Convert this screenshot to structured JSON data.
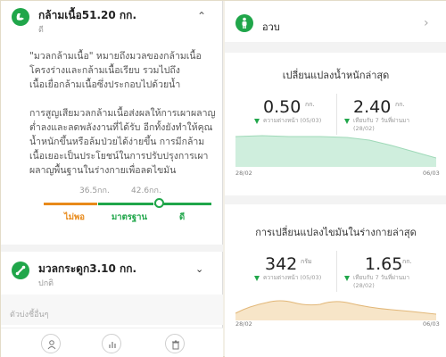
{
  "colors": {
    "accent": "#20a64a",
    "warning": "#e88a1a",
    "chart_green": "#cfeedd",
    "chart_orange": "#f7e5c8"
  },
  "muscle": {
    "title": "กล้ามเนื้อ51.20 กก.",
    "status": "ดี",
    "description": "\"มวลกล้ามเนื้อ\" หมายถึงมวลของกล้ามเนื้อโครงร่างและกล้ามเนื้อเรียบ รวมไปถึงเนื้อเยื่อกล้ามเนื้อซึ่งประกอบไปด้วยน้ำ",
    "advice": "การสูญเสียมวลกล้ามเนื้อส่งผลให้การเผาผลาญต่ำลงและลดพลังงานที่ได้รับ อีกทั้งยังทำให้คุณน้ำหนักขึ้นหรือล้มป่วยได้ง่ายขึ้น การมีกล้ามเนื้อเยอะเป็นประโยชน์ในการปรับปรุงการเผาผลาญพื้นฐานในร่างกายเพื่อลดไขมัน",
    "scale": {
      "threshold_low": "36.5กก.",
      "threshold_high": "42.6กก.",
      "labels": [
        "ไม่พอ",
        "มาตรฐาน",
        "ดี"
      ]
    }
  },
  "bone": {
    "title": "มวลกระดูก3.10 กก.",
    "status": "ปกติ"
  },
  "other_metrics_label": "ตัวบ่งชี้อื่นๆ",
  "icons": {
    "muscle": "muscle-icon",
    "bone": "bone-icon",
    "body": "body-icon",
    "bottom_nav": [
      "person-icon",
      "chart-icon",
      "trash-icon"
    ]
  },
  "right": {
    "header_title": "อวบ",
    "weight_card": {
      "title": "เปลี่ยนแปลงน้ำหนักล่าสุด",
      "left_value": "0.50",
      "left_unit": "กก.",
      "left_caption": "ความต่างหน้า (05/03)",
      "right_value": "2.40",
      "right_unit": "กก.",
      "right_caption_line1": "เทียบกับ 7 วันที่ผ่านมา",
      "right_caption_line2": "(28/02)",
      "date_start": "28/02",
      "date_end": "06/03"
    },
    "fat_card": {
      "title": "การเปลี่ยนแปลงไขมันในร่างกายล่าสุด",
      "left_value": "342",
      "left_unit": "กรัม",
      "left_caption": "ความต่างหน้า (05/03)",
      "right_value": "1.65",
      "right_unit": "กก.",
      "right_caption_line1": "เทียบกับ 7 วันที่ผ่านมา",
      "right_caption_line2": "(28/02)",
      "date_start": "28/02",
      "date_end": "06/03"
    }
  }
}
